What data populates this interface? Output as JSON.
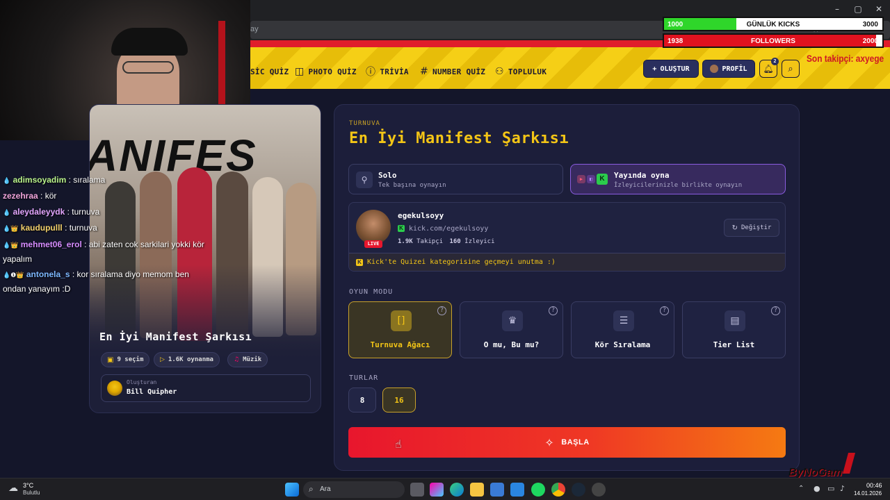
{
  "browser": {
    "url_fragment": "ay",
    "window_controls": {
      "minimize": "–",
      "maximize": "▢",
      "close": "✕"
    }
  },
  "stream_overlay": {
    "stats": [
      {
        "current": "1000",
        "label": "GÜNLÜK KICKS",
        "goal": "3000",
        "progress": 0.33,
        "color": "#2fd62a"
      },
      {
        "current": "1938",
        "label": "FOLLOWERS",
        "goal": "2000",
        "progress": 0.97,
        "color": "#e0121f"
      }
    ],
    "last_follower": "Son takipçi: axyege",
    "chat": [
      {
        "badge": "💧",
        "user": "adimsoyadim",
        "user_color": "#b9f28a",
        "message": " : sıralama"
      },
      {
        "badge": "",
        "user": "zezehraa",
        "user_color": "#f2a6dc",
        "message": " : kör"
      },
      {
        "badge": "💧",
        "user": "aleydaleyydk",
        "user_color": "#e3a6ff",
        "message": " : turnuva"
      },
      {
        "badge": "💧👑",
        "user": "kaudupulll",
        "user_color": "#f2d06b",
        "message": " : turnuva"
      },
      {
        "badge": "💧👑",
        "user": "mehmet06_erol",
        "user_color": "#d68cff",
        "message": " : abi zaten cok sarkilari yokki kör yapalım"
      },
      {
        "badge": "💧❶👑",
        "user": "antonela_s",
        "user_color": "#7db8ff",
        "message": " : kor sıralama diyo memom ben ondan yanayım :D"
      }
    ]
  },
  "header": {
    "nav": [
      {
        "icon": "",
        "label": "SİC QUİZ"
      },
      {
        "icon": "📷",
        "label": "PHOTO QUİZ"
      },
      {
        "icon": "?",
        "label": "TRİVİA"
      },
      {
        "icon": "#",
        "label": "NUMBER QUİZ"
      },
      {
        "icon": "👥",
        "label": "TOPLULUK"
      }
    ],
    "create_label": "OLUŞTUR",
    "profile_label": "PROFİL",
    "notif_count": "2"
  },
  "quiz": {
    "cover_title": "En İyi Manifest Şarkısı",
    "cover_text": "ANIFES",
    "stats": [
      {
        "icon": "🖼",
        "label": "9 seçim"
      },
      {
        "icon": "▷",
        "label": "1.6K oynanma"
      },
      {
        "icon": "🎸",
        "label": "Müzik"
      }
    ],
    "creator_caption": "Oluşturan",
    "creator_name": "Bill Quipher"
  },
  "panel": {
    "eyebrow": "TURNUVA",
    "title": "En İyi Manifest Şarkısı",
    "play_modes": [
      {
        "title": "Solo",
        "subtitle": "Tek başına oynayın",
        "selected": false
      },
      {
        "title": "Yayında oyna",
        "subtitle": "İzleyicilerinizle birlikte oynayın",
        "selected": true
      }
    ],
    "streamer": {
      "name": "egekulsoyy",
      "channel": "kick.com/egekulsoyy",
      "followers": "1.9K",
      "followers_label": "Takipçi",
      "viewers": "160",
      "viewers_label": "İzleyici",
      "live_badge": "LIVE",
      "change_label": "Değiştir",
      "notice": "Kick'te Quizei kategorisine geçmeyi unutma :)"
    },
    "game_mode_heading": "OYUN MODU",
    "game_modes": [
      {
        "icon": "[]",
        "label": "Turnuva Ağacı",
        "selected": true
      },
      {
        "icon": "♛",
        "label": "O mu, Bu mu?",
        "selected": false
      },
      {
        "icon": "☰",
        "label": "Kör Sıralama",
        "selected": false
      },
      {
        "icon": "▤",
        "label": "Tier List",
        "selected": false
      }
    ],
    "rounds_heading": "TURLAR",
    "rounds": [
      {
        "label": "8",
        "selected": false
      },
      {
        "label": "16",
        "selected": true
      }
    ],
    "start_label": "BAŞLA"
  },
  "taskbar": {
    "weather_temp": "3°C",
    "weather_desc": "Bulutlu",
    "search_placeholder": "Ara",
    "time": "00:46",
    "date": "14.01.2026"
  },
  "watermark": "ByNoGam"
}
